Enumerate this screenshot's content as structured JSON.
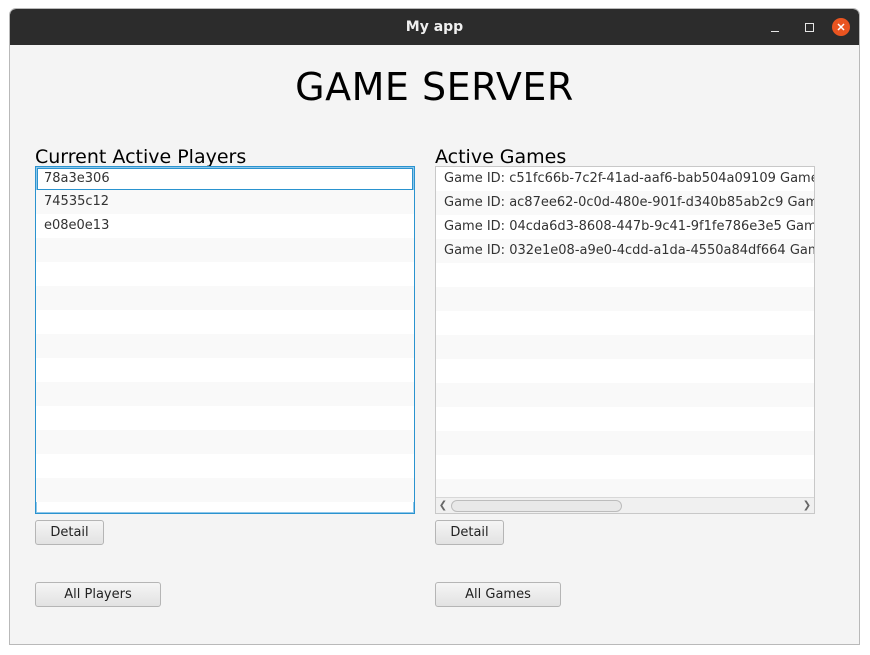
{
  "window": {
    "title": "My app"
  },
  "heading": "GAME SERVER",
  "players": {
    "label": "Current Active Players",
    "items": [
      "78a3e306",
      "74535c12",
      "e08e0e13"
    ],
    "selected_index": 0,
    "detail_label": "Detail",
    "all_label": "All Players"
  },
  "games": {
    "label": "Active Games",
    "items": [
      "Game ID: c51fc66b-7c2f-41ad-aaf6-bab504a09109 Game",
      "Game ID: ac87ee62-0c0d-480e-901f-d340b85ab2c9 Gam",
      "Game ID: 04cda6d3-8608-447b-9c41-9f1fe786e3e5 Gam",
      "Game ID: 032e1e08-a9e0-4cdd-a1da-4550a84df664 Gam"
    ],
    "detail_label": "Detail",
    "all_label": "All Games"
  },
  "colors": {
    "accent": "#2a93cf",
    "close_button": "#e95420",
    "titlebar": "#2c2c2c"
  }
}
